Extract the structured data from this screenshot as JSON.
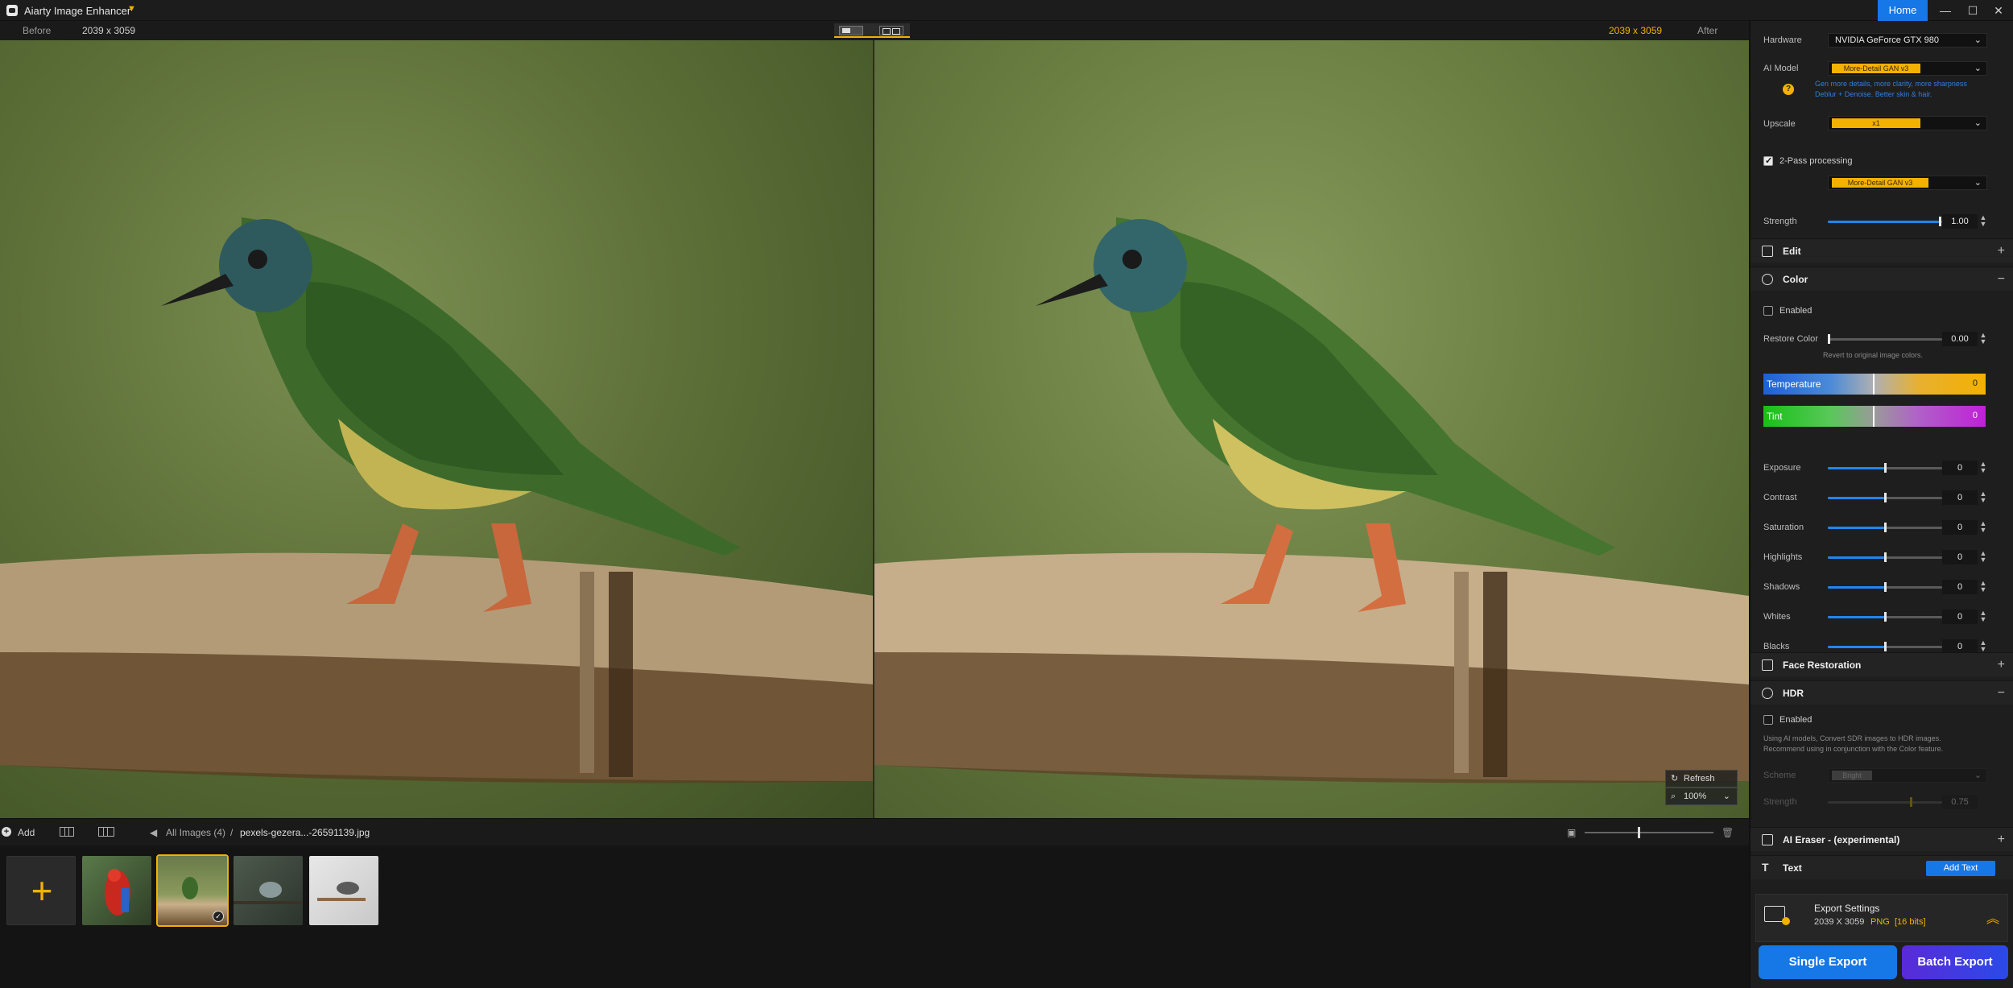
{
  "app": {
    "title": "Aiarty Image Enhancer",
    "home_label": "Home"
  },
  "compare": {
    "before_label": "Before",
    "before_dims": "2039 x 3059",
    "after_dims": "2039 x 3059",
    "after_label": "After"
  },
  "viewer": {
    "refresh_label": "Refresh",
    "zoom": "100%"
  },
  "toolbar": {
    "add_label": "Add",
    "breadcrumb_root": "All Images (4)",
    "breadcrumb_sep": "/",
    "breadcrumb_file": "pexels-gezera...-26591139.jpg"
  },
  "thumbs": [
    {
      "name": "parrot",
      "selected": false
    },
    {
      "name": "bird-on-bamboo",
      "selected": true
    },
    {
      "name": "bird-on-branch",
      "selected": false
    },
    {
      "name": "bird-on-white",
      "selected": false
    }
  ],
  "panel": {
    "hardware": {
      "label": "Hardware",
      "value": "NVIDIA GeForce GTX 980"
    },
    "ai_model": {
      "label": "AI Model",
      "value": "More-Detail GAN  v3",
      "help_line1": "Gen more details, more clarity, more sharpness",
      "help_line2": "Deblur + Denoise. Better skin & hair."
    },
    "upscale": {
      "label": "Upscale",
      "value": "x1"
    },
    "two_pass": {
      "label": "2-Pass processing",
      "checked": true,
      "model": "More-Detail GAN  v3"
    },
    "strength": {
      "label": "Strength",
      "value": "1.00",
      "level": 1.0
    },
    "sections": {
      "edit": "Edit",
      "color": "Color",
      "face": "Face Restoration",
      "hdr": "HDR",
      "eraser": "AI Eraser - (experimental)",
      "text": "Text"
    },
    "color": {
      "enabled_label": "Enabled",
      "restore_label": "Restore Color",
      "restore_value": "0.00",
      "restore_hint": "Revert to original image colors.",
      "temperature_label": "Temperature",
      "temperature_value": "0",
      "tint_label": "Tint",
      "tint_value": "0",
      "adjustments": [
        {
          "label": "Exposure",
          "value": "0"
        },
        {
          "label": "Contrast",
          "value": "0"
        },
        {
          "label": "Saturation",
          "value": "0"
        },
        {
          "label": "Highlights",
          "value": "0"
        },
        {
          "label": "Shadows",
          "value": "0"
        },
        {
          "label": "Whites",
          "value": "0"
        },
        {
          "label": "Blacks",
          "value": "0"
        }
      ]
    },
    "hdr": {
      "enabled_label": "Enabled",
      "desc_line1": "Using AI models, Convert SDR images to HDR images.",
      "desc_line2": "Recommend using in conjunction with the Color feature.",
      "scheme_label": "Scheme",
      "scheme_value": "Bright",
      "strength_label": "Strength",
      "strength_value": "0.75"
    },
    "text": {
      "add_text_label": "Add Text"
    },
    "export_settings": {
      "title": "Export Settings",
      "dims": "2039 X 3059",
      "format": "PNG",
      "bits": "[16 bits]"
    },
    "single_export": "Single Export",
    "batch_export": "Batch Export"
  },
  "colors": {
    "accent": "#f3b100",
    "primary": "#1677e6"
  }
}
